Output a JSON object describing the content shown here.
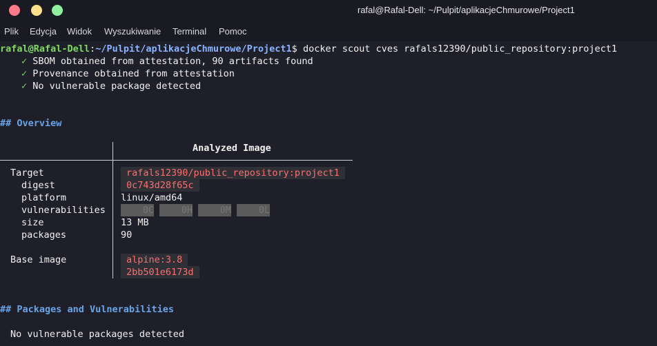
{
  "window": {
    "title": "rafal@Rafal-Dell: ~/Pulpit/aplikacjeChmurowe/Project1"
  },
  "menu": [
    "Plik",
    "Edycja",
    "Widok",
    "Wyszukiwanie",
    "Terminal",
    "Pomoc"
  ],
  "prompt": {
    "user": "rafal@Rafal-Dell",
    "sep": ":",
    "path": "~/Pulpit/aplikacjeChmurowe/Project1",
    "dollar": "$",
    "command": " docker scout cves rafals12390/public_repository:project1"
  },
  "status": [
    {
      "mark": "✓",
      "text": "SBOM obtained from attestation, 90 artifacts found"
    },
    {
      "mark": "✓",
      "text": "Provenance obtained from attestation"
    },
    {
      "mark": "✓",
      "text": "No vulnerable package detected"
    }
  ],
  "overview": {
    "heading": "## Overview",
    "column_header": "Analyzed Image",
    "target_label": "Target",
    "target_value": "rafals12390/public_repository:project1",
    "digest_label": "digest",
    "digest_value": "0c743d28f65c",
    "platform_label": "platform",
    "platform_value": "linux/amd64",
    "vulnerabilities_label": "vulnerabilities",
    "vulnerabilities": [
      "0C",
      "0H",
      "0M",
      "0L"
    ],
    "size_label": "size",
    "size_value": "13 MB",
    "packages_label": "packages",
    "packages_value": "90",
    "base_label": "Base image",
    "base_value": "alpine:3.8",
    "base_digest": "2bb501e6173d"
  },
  "packages": {
    "heading": "## Packages and Vulnerabilities",
    "message": "No vulnerable packages detected"
  },
  "colors": {
    "user": "#7fd962",
    "path": "#8ab4ff",
    "heading": "#6aa4e8",
    "badge": "#ff6e6e"
  }
}
